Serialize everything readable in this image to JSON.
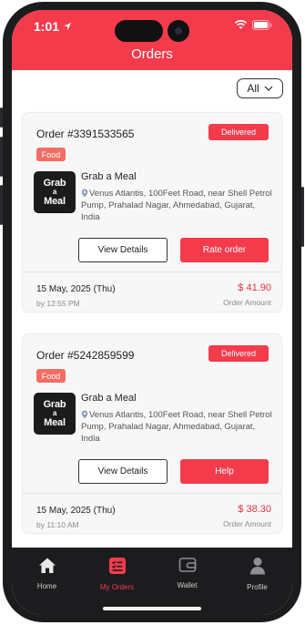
{
  "status_bar": {
    "time": "1:01"
  },
  "header": {
    "title": "Orders"
  },
  "filter": {
    "selected": "All"
  },
  "orders": [
    {
      "order_number": "Order #3391533565",
      "status": "Delivered",
      "category": "Food",
      "logo_text": [
        "Grab",
        "a",
        "Meal"
      ],
      "store_name": "Grab a Meal",
      "address": "Venus Atlantis, 100Feet Road, near Shell Petrol Pump, Prahalad Nagar, Ahmedabad, Gujarat, India",
      "primary_action": "View Details",
      "secondary_action": "Rate order",
      "date": "15 May, 2025 (Thu)",
      "time": "by 12:55 PM",
      "amount": "$ 41.90",
      "amount_label": "Order Amount"
    },
    {
      "order_number": "Order #5242859599",
      "status": "Delivered",
      "category": "Food",
      "logo_text": [
        "Grab",
        "a",
        "Meal"
      ],
      "store_name": "Grab a Meal",
      "address": "Venus Atlantis, 100Feet Road, near Shell Petrol Pump, Prahalad Nagar, Ahmedabad, Gujarat, India",
      "primary_action": "View Details",
      "secondary_action": "Help",
      "date": "15 May, 2025 (Thu)",
      "time": "by 11:10 AM",
      "amount": "$ 38.30",
      "amount_label": "Order Amount"
    }
  ],
  "tabs": [
    {
      "label": "Home",
      "icon": "home-icon",
      "active": false
    },
    {
      "label": "My Orders",
      "icon": "orders-icon",
      "active": true
    },
    {
      "label": "Wallet",
      "icon": "wallet-icon",
      "active": false
    },
    {
      "label": "Profile",
      "icon": "profile-icon",
      "active": false
    }
  ],
  "colors": {
    "accent": "#f43b4c",
    "category_badge": "#f26d64",
    "tabbar": "#1c1c1e"
  }
}
